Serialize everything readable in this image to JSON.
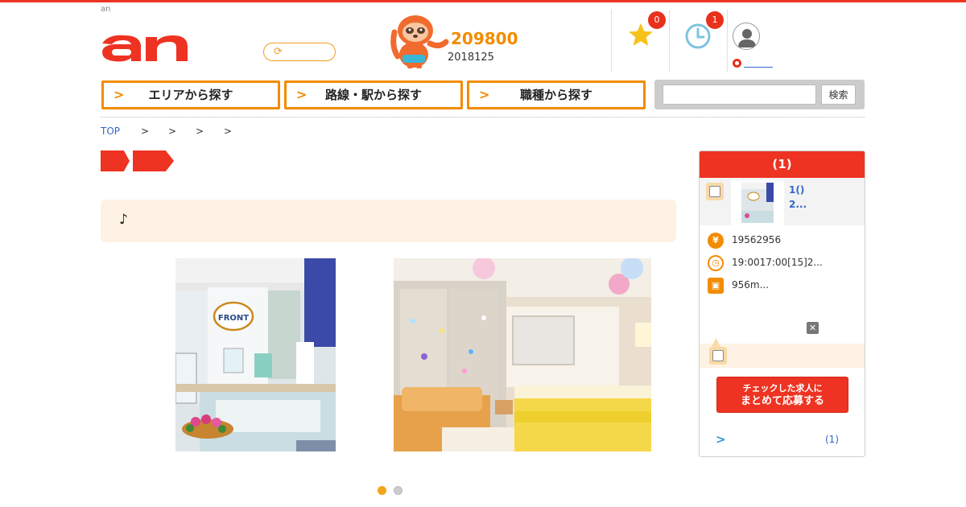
{
  "header": {
    "small_label": "an",
    "logo_text": "an",
    "job_count": "209800",
    "updated": "2018125",
    "favorites_badge": "0",
    "history_badge": "1"
  },
  "nav": {
    "area": "エリアから探す",
    "route": "路線・駅から探す",
    "job_type": "職種から探す",
    "search_placeholder": "",
    "search_button": "検索"
  },
  "breadcrumb": {
    "top": "TOP",
    "separators": [
      ">",
      ">",
      ">",
      ">"
    ]
  },
  "notice": "♪",
  "carousel": {
    "dots_count": 2,
    "active_index": 0,
    "front_sign": "FRONT"
  },
  "sidebar": {
    "title": "(1)",
    "item": {
      "line1": "1()",
      "line2": "2..."
    },
    "salary": "19562956",
    "hours": "19:0017:00[15]2...",
    "access": "956m...",
    "apply_button_line1": "チェックした求人に",
    "apply_button_line2": "まとめて応募する",
    "more_count": "(1)"
  },
  "colors": {
    "brand_red": "#ee3322",
    "brand_orange": "#f28c00",
    "notice_bg": "#fdf2e3"
  }
}
